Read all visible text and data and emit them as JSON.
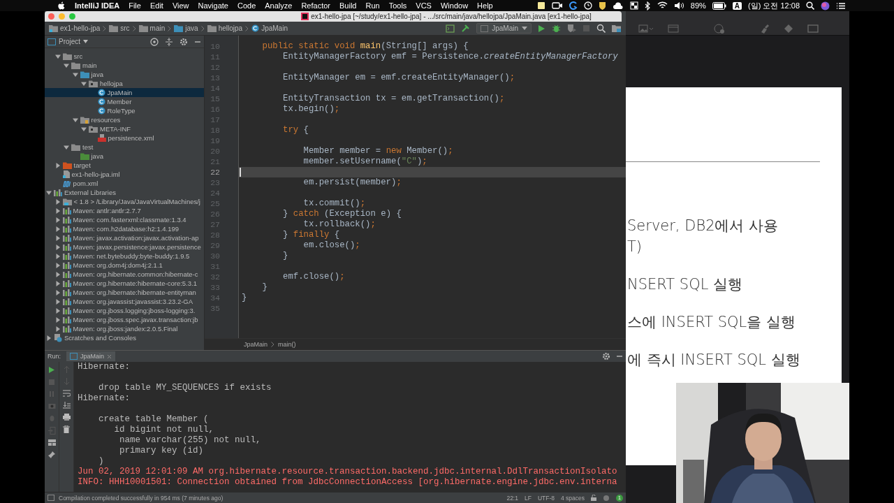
{
  "menu_bar": {
    "app": "IntelliJ IDEA",
    "menus": [
      "File",
      "Edit",
      "View",
      "Navigate",
      "Code",
      "Analyze",
      "Refactor",
      "Build",
      "Run",
      "Tools",
      "VCS",
      "Window",
      "Help"
    ],
    "battery": "89%",
    "input_source": "A",
    "clock": "(일) 오전 12:08"
  },
  "window": {
    "title": "ex1-hello-jpa [~/study/ex1-hello-jpa] - .../src/main/java/hellojpa/JpaMain.java [ex1-hello-jpa]"
  },
  "breadcrumbs": [
    {
      "label": "ex1-hello-jpa",
      "kind": "module"
    },
    {
      "label": "src",
      "kind": "folder"
    },
    {
      "label": "main",
      "kind": "folder"
    },
    {
      "label": "java",
      "kind": "source"
    },
    {
      "label": "hellojpa",
      "kind": "package"
    },
    {
      "label": "JpaMain",
      "kind": "class"
    }
  ],
  "toolbar": {
    "run_config": "JpaMain"
  },
  "project_panel": {
    "title": "Project",
    "module_items": [
      {
        "label": "src",
        "kind": "folder",
        "expanded": true,
        "selected": false,
        "children": [
          {
            "label": "main",
            "kind": "folder",
            "expanded": true,
            "selected": false,
            "children": [
              {
                "label": "java",
                "kind": "source",
                "expanded": true,
                "selected": false,
                "children": [
                  {
                    "label": "hellojpa",
                    "kind": "package",
                    "expanded": true,
                    "selected": false,
                    "children": [
                      {
                        "label": "JpaMain",
                        "kind": "class",
                        "selected": true
                      },
                      {
                        "label": "Member",
                        "kind": "class",
                        "selected": false
                      },
                      {
                        "label": "RoleType",
                        "kind": "class",
                        "selected": false
                      }
                    ]
                  }
                ]
              },
              {
                "label": "resources",
                "kind": "resources",
                "expanded": true,
                "selected": false,
                "children": [
                  {
                    "label": "META-INF",
                    "kind": "package",
                    "expanded": true,
                    "selected": false,
                    "children": [
                      {
                        "label": "persistence.xml",
                        "kind": "xml",
                        "selected": false
                      }
                    ]
                  }
                ]
              }
            ]
          },
          {
            "label": "test",
            "kind": "folder",
            "expanded": true,
            "selected": false,
            "children": [
              {
                "label": "java",
                "kind": "test",
                "selected": false
              }
            ]
          }
        ]
      },
      {
        "label": "target",
        "kind": "excluded",
        "expanded": false,
        "selected": false
      },
      {
        "label": "ex1-hello-jpa.iml",
        "kind": "module",
        "selected": false
      },
      {
        "label": "pom.xml",
        "kind": "maven",
        "selected": false
      }
    ],
    "root_items": [
      {
        "label": "External Libraries",
        "kind": "libraries",
        "expanded": true,
        "selected": false,
        "children": [
          {
            "label": "< 1.8 > /Library/Java/JavaVirtualMachines/j",
            "kind": "sdk",
            "expanded": false,
            "selected": false
          },
          {
            "label": "Maven: antlr:antlr:2.7.7",
            "kind": "library",
            "expanded": false,
            "selected": false
          },
          {
            "label": "Maven: com.fasterxml:classmate:1.3.4",
            "kind": "library",
            "expanded": false,
            "selected": false
          },
          {
            "label": "Maven: com.h2database:h2:1.4.199",
            "kind": "library",
            "expanded": false,
            "selected": false
          },
          {
            "label": "Maven: javax.activation:javax.activation-ap",
            "kind": "library",
            "expanded": false,
            "selected": false
          },
          {
            "label": "Maven: javax.persistence:javax.persistence",
            "kind": "library",
            "expanded": false,
            "selected": false
          },
          {
            "label": "Maven: net.bytebuddy:byte-buddy:1.9.5",
            "kind": "library",
            "expanded": false,
            "selected": false
          },
          {
            "label": "Maven: org.dom4j:dom4j:2.1.1",
            "kind": "library",
            "expanded": false,
            "selected": false
          },
          {
            "label": "Maven: org.hibernate.common:hibernate-c",
            "kind": "library",
            "expanded": false,
            "selected": false
          },
          {
            "label": "Maven: org.hibernate:hibernate-core:5.3.1",
            "kind": "library",
            "expanded": false,
            "selected": false
          },
          {
            "label": "Maven: org.hibernate:hibernate-entityman",
            "kind": "library",
            "expanded": false,
            "selected": false
          },
          {
            "label": "Maven: org.javassist:javassist:3.23.2-GA",
            "kind": "library",
            "expanded": false,
            "selected": false
          },
          {
            "label": "Maven: org.jboss.logging:jboss-logging:3.",
            "kind": "library",
            "expanded": false,
            "selected": false
          },
          {
            "label": "Maven: org.jboss.spec.javax.transaction:jb",
            "kind": "library",
            "expanded": false,
            "selected": false
          },
          {
            "label": "Maven: org.jboss:jandex:2.0.5.Final",
            "kind": "library",
            "expanded": false,
            "selected": false
          }
        ]
      },
      {
        "label": "Scratches and Consoles",
        "kind": "scratches",
        "expanded": false,
        "selected": false
      }
    ]
  },
  "editor": {
    "lines": [
      {
        "number": "10",
        "current": false,
        "tokens": [
          {
            "kind": "keyword",
            "text": "    public static void "
          },
          {
            "kind": "method",
            "text": "main"
          },
          {
            "kind": "plain",
            "text": "(String[] args) {"
          }
        ]
      },
      {
        "number": "11",
        "current": false,
        "tokens": [
          {
            "kind": "plain",
            "text": "        EntityManagerFactory emf = Persistence."
          },
          {
            "kind": "static_call",
            "text": "createEntityManagerFactory"
          }
        ]
      },
      {
        "number": "12",
        "current": false
      },
      {
        "number": "13",
        "current": false,
        "tokens": [
          {
            "kind": "plain",
            "text": "        EntityManager em = emf.createEntityManager()"
          },
          {
            "kind": "keyword",
            "text": ";"
          }
        ]
      },
      {
        "number": "14",
        "current": false
      },
      {
        "number": "15",
        "current": false,
        "tokens": [
          {
            "kind": "plain",
            "text": "        EntityTransaction tx = em.getTransaction()"
          },
          {
            "kind": "keyword",
            "text": ";"
          }
        ]
      },
      {
        "number": "16",
        "current": false,
        "tokens": [
          {
            "kind": "plain",
            "text": "        tx.begin()"
          },
          {
            "kind": "keyword",
            "text": ";"
          }
        ]
      },
      {
        "number": "17",
        "current": false
      },
      {
        "number": "18",
        "current": false,
        "tokens": [
          {
            "kind": "keyword",
            "text": "        try"
          },
          {
            "kind": "plain",
            "text": " {"
          }
        ]
      },
      {
        "number": "19",
        "current": false
      },
      {
        "number": "20",
        "current": false,
        "tokens": [
          {
            "kind": "plain",
            "text": "            Member member = "
          },
          {
            "kind": "keyword",
            "text": "new"
          },
          {
            "kind": "plain",
            "text": " Member()"
          },
          {
            "kind": "keyword",
            "text": ";"
          }
        ]
      },
      {
        "number": "21",
        "current": false,
        "tokens": [
          {
            "kind": "plain",
            "text": "            member.setUsername("
          },
          {
            "kind": "string",
            "text": "\"C\""
          },
          {
            "kind": "plain",
            "text": ")"
          },
          {
            "kind": "keyword",
            "text": ";"
          }
        ]
      },
      {
        "number": "22",
        "current": true
      },
      {
        "number": "23",
        "current": false,
        "tokens": [
          {
            "kind": "plain",
            "text": "            em.persist(member)"
          },
          {
            "kind": "keyword",
            "text": ";"
          }
        ]
      },
      {
        "number": "24",
        "current": false
      },
      {
        "number": "25",
        "current": false,
        "tokens": [
          {
            "kind": "plain",
            "text": "            tx.commit()"
          },
          {
            "kind": "keyword",
            "text": ";"
          }
        ]
      },
      {
        "number": "26",
        "current": false,
        "tokens": [
          {
            "kind": "plain",
            "text": "        } "
          },
          {
            "kind": "keyword",
            "text": "catch"
          },
          {
            "kind": "plain",
            "text": " (Exception e) {"
          }
        ]
      },
      {
        "number": "27",
        "current": false,
        "tokens": [
          {
            "kind": "plain",
            "text": "            tx.rollback()"
          },
          {
            "kind": "keyword",
            "text": ";"
          }
        ]
      },
      {
        "number": "28",
        "current": false,
        "tokens": [
          {
            "kind": "plain",
            "text": "        } "
          },
          {
            "kind": "keyword",
            "text": "finally"
          },
          {
            "kind": "plain",
            "text": " {"
          }
        ]
      },
      {
        "number": "29",
        "current": false,
        "tokens": [
          {
            "kind": "plain",
            "text": "            em.close()"
          },
          {
            "kind": "keyword",
            "text": ";"
          }
        ]
      },
      {
        "number": "30",
        "current": false,
        "tokens": [
          {
            "kind": "plain",
            "text": "        }"
          }
        ]
      },
      {
        "number": "31",
        "current": false
      },
      {
        "number": "32",
        "current": false,
        "tokens": [
          {
            "kind": "plain",
            "text": "        emf.close()"
          },
          {
            "kind": "keyword",
            "text": ";"
          }
        ]
      },
      {
        "number": "33",
        "current": false,
        "tokens": [
          {
            "kind": "plain",
            "text": "    }"
          }
        ]
      },
      {
        "number": "34",
        "current": false,
        "tokens": [
          {
            "kind": "plain",
            "text": "}"
          }
        ]
      },
      {
        "number": "35",
        "current": false
      }
    ],
    "breadcrumbs": [
      "JpaMain",
      "main()"
    ]
  },
  "run_panel": {
    "label": "Run:",
    "tab": "JpaMain",
    "lines": [
      {
        "kind": "out",
        "text": "Hibernate:"
      },
      {
        "kind": "blank"
      },
      {
        "kind": "out",
        "text": "    drop table MY_SEQUENCES if exists"
      },
      {
        "kind": "out",
        "text": "Hibernate:"
      },
      {
        "kind": "blank"
      },
      {
        "kind": "out",
        "text": "    create table Member ("
      },
      {
        "kind": "out",
        "text": "       id bigint not null,"
      },
      {
        "kind": "out",
        "text": "        name varchar(255) not null,"
      },
      {
        "kind": "out",
        "text": "        primary key (id)"
      },
      {
        "kind": "out",
        "text": "    )"
      },
      {
        "kind": "err",
        "text": "Jun 02, 2019 12:01:09 AM org.hibernate.resource.transaction.backend.jdbc.internal.DdlTransactionIsolato"
      },
      {
        "kind": "err",
        "text": "INFO: HHH10001501: Connection obtained from JdbcConnectionAccess [org.hibernate.engine.jdbc.env.interna"
      }
    ]
  },
  "status_bar": {
    "message": "Compilation completed successfully in 954 ms (7 minutes ago)",
    "position": "22:1",
    "line_separator": "LF",
    "encoding": "UTF-8",
    "indent": "4 spaces",
    "notifications": "1"
  },
  "slide": {
    "paragraphs": [
      [
        "Server, DB2에서 사용",
        "T)"
      ],
      [
        "NSERT SQL 실행"
      ],
      [
        "스에 INSERT SQL을 실행"
      ],
      [
        "에 즉시 INSERT SQL 실행"
      ]
    ]
  }
}
